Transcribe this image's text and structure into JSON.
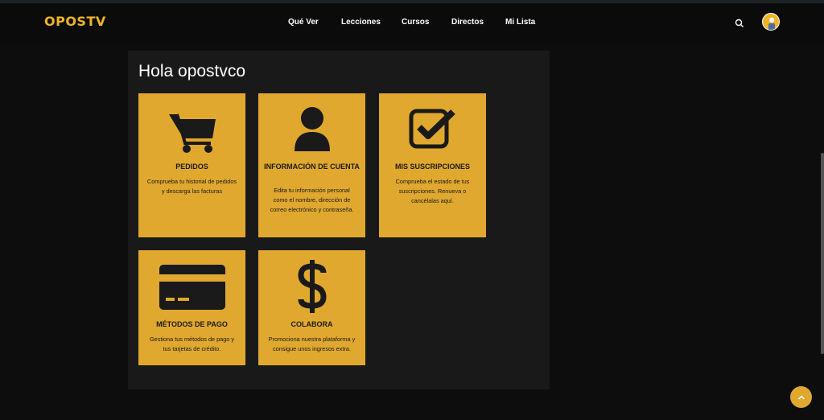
{
  "header": {
    "logo": "OPOSTV",
    "nav": [
      "Qué Ver",
      "Lecciones",
      "Cursos",
      "Directos",
      "Mi Lista"
    ]
  },
  "account": {
    "greeting": "Hola opostvco",
    "cards": [
      {
        "icon": "cart-icon",
        "title": "PEDIDOS",
        "description": "Comprueba tu historial de pedidos y descarga las facturas"
      },
      {
        "icon": "user-icon",
        "title": "INFORMACIÓN DE CUENTA",
        "description": "Edita tu información personal como el nombre, dirección de correo electrónico y contraseña."
      },
      {
        "icon": "checkbox-icon",
        "title": "MIS SUSCRIPCIONES",
        "description": "Comprueba el estado de tus suscripciones. Renueva o cancélalas aquí."
      },
      {
        "icon": "credit-card-icon",
        "title": "MÉTODOS DE PAGO",
        "description": "Gestiona tus métodos de pago y tus tarjetas de crédito."
      },
      {
        "icon": "dollar-icon",
        "title": "COLABORA",
        "description": "Promociona nuestra plataforma y consigue unos ingresos extra."
      }
    ]
  },
  "colors": {
    "accent": "#e0a82e",
    "logo": "#f0b429",
    "panel": "#191919",
    "background": "#0d0d0d"
  }
}
